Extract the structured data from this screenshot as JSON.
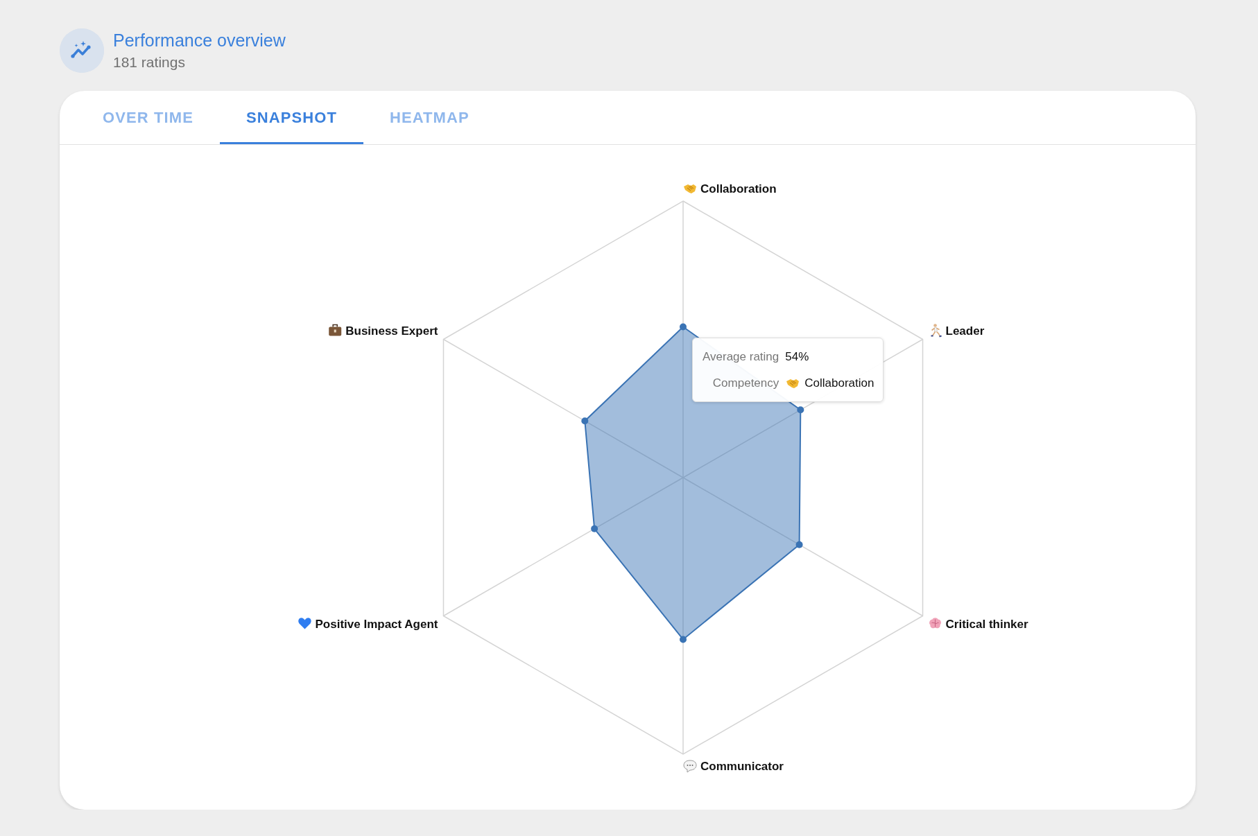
{
  "header": {
    "title": "Performance overview",
    "subtitle": "181 ratings"
  },
  "tabs": [
    {
      "label": "OVER TIME",
      "selected": false
    },
    {
      "label": "SNAPSHOT",
      "selected": true
    },
    {
      "label": "HEATMAP",
      "selected": false
    }
  ],
  "radar": {
    "axes": [
      {
        "label": "Collaboration",
        "kind": "handshake"
      },
      {
        "label": "Business Expert",
        "kind": "briefcase"
      },
      {
        "label": "Leader",
        "kind": "runner"
      },
      {
        "label": "Positive Impact Agent",
        "kind": "heart"
      },
      {
        "label": "Critical thinker",
        "kind": "brain"
      },
      {
        "label": "Communicator",
        "kind": "speech"
      }
    ]
  },
  "tooltip": {
    "rows": [
      {
        "label": "Average rating",
        "value": "54%"
      },
      {
        "label": "Competency",
        "value": "Collaboration",
        "kind": "handshake"
      }
    ]
  }
}
